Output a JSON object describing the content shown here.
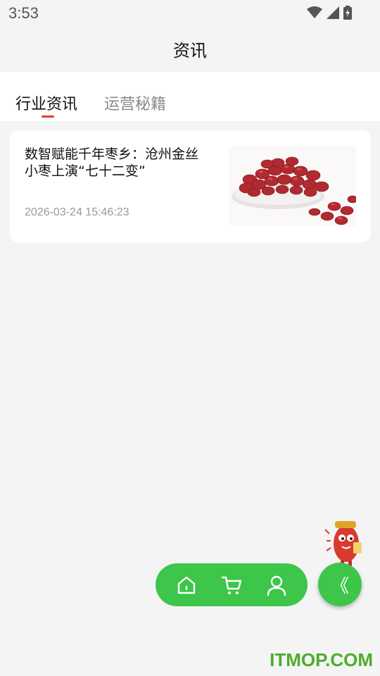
{
  "status_bar": {
    "time": "3:53"
  },
  "header": {
    "title": "资讯"
  },
  "tabs": [
    {
      "label": "行业资讯",
      "active": true
    },
    {
      "label": "运营秘籍",
      "active": false
    }
  ],
  "news": [
    {
      "title": "数智赋能千年枣乡：沧州金丝小枣上演“七十二变”",
      "time": "2026-03-24 15:46:23",
      "image": "red-dates-photo"
    }
  ],
  "float_nav": {
    "items": [
      {
        "name": "home",
        "icon": "home-icon"
      },
      {
        "name": "cart",
        "icon": "cart-icon"
      },
      {
        "name": "profile",
        "icon": "user-icon"
      }
    ],
    "collapse_icon": "《"
  },
  "watermark": "ITMOP.COM",
  "colors": {
    "accent_green": "#3dc64a",
    "tab_indicator": "#e0421e",
    "background": "#f4f4f5"
  }
}
